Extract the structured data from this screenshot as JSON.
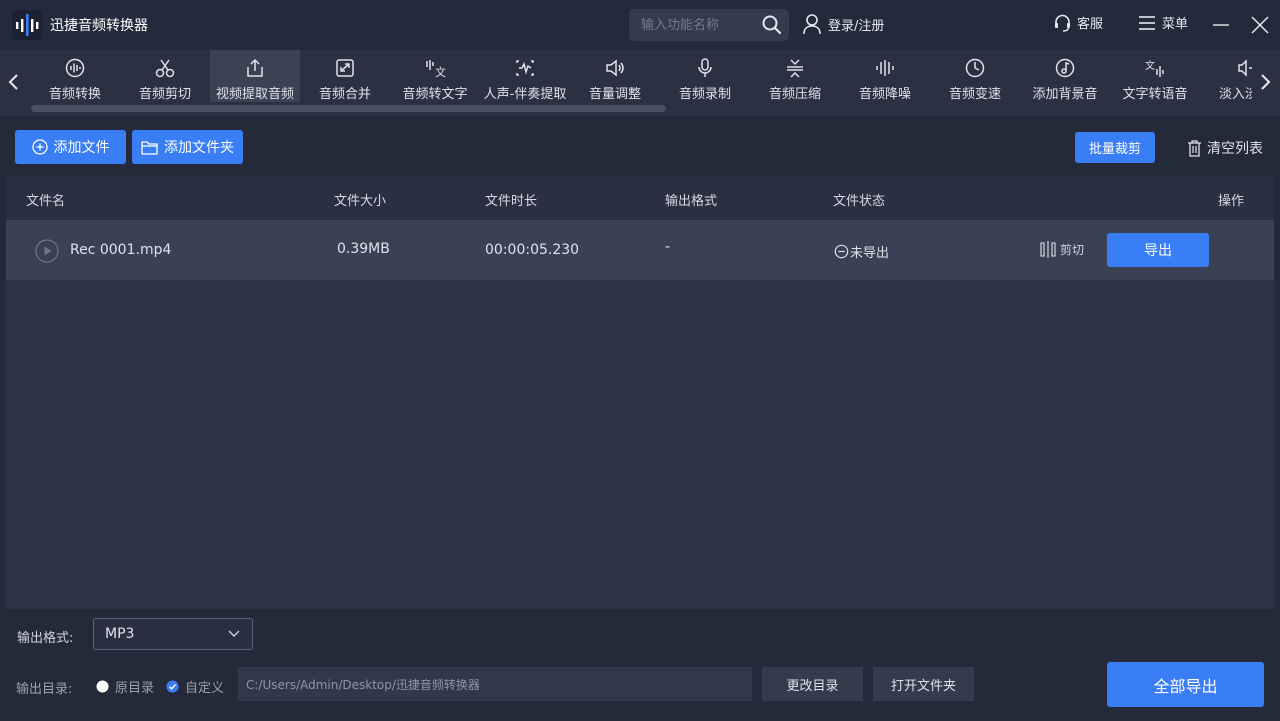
{
  "app": {
    "title": "迅捷音频转换器"
  },
  "header": {
    "search_placeholder": "输入功能名称",
    "login_label": "登录/注册",
    "service_label": "客服",
    "menu_label": "菜单"
  },
  "tools": [
    {
      "label": "音频转换",
      "icon": "waveform-circle-icon"
    },
    {
      "label": "音频剪切",
      "icon": "scissors-icon"
    },
    {
      "label": "视频提取音频",
      "icon": "upload-box-icon",
      "active": true
    },
    {
      "label": "音频合并",
      "icon": "merge-icon"
    },
    {
      "label": "音频转文字",
      "icon": "audio-to-text-icon"
    },
    {
      "label": "人声-伴奏提取",
      "icon": "vocal-extract-icon"
    },
    {
      "label": "音量调整",
      "icon": "volume-icon"
    },
    {
      "label": "音频录制",
      "icon": "microphone-icon"
    },
    {
      "label": "音频压缩",
      "icon": "compress-icon"
    },
    {
      "label": "音频降噪",
      "icon": "denoise-icon"
    },
    {
      "label": "音频变速",
      "icon": "speed-gauge-icon"
    },
    {
      "label": "添加背景音",
      "icon": "music-note-icon"
    },
    {
      "label": "文字转语音",
      "icon": "text-to-speech-icon"
    },
    {
      "label": "淡入淡出",
      "icon": "fade-icon"
    }
  ],
  "actions": {
    "add_file": "添加文件",
    "add_folder": "添加文件夹",
    "batch_cut": "批量裁剪",
    "clear_list": "清空列表"
  },
  "table": {
    "headers": {
      "name": "文件名",
      "size": "文件大小",
      "duration": "文件时长",
      "format": "输出格式",
      "status": "文件状态",
      "ops": "操作"
    },
    "rows": [
      {
        "name": "Rec 0001.mp4",
        "size": "0.39MB",
        "duration": "00:00:05.230",
        "format": "-",
        "status": "未导出",
        "cut_label": "剪切",
        "export_label": "导出"
      }
    ]
  },
  "bottom": {
    "format_label": "输出格式:",
    "format_value": "MP3",
    "dir_label": "输出目录:",
    "radio_original": "原目录",
    "radio_custom": "自定义",
    "radio_selected": "custom",
    "path": "C:/Users/Admin/Desktop/迅捷音频转换器",
    "change_dir": "更改目录",
    "open_folder": "打开文件夹",
    "export_all": "全部导出"
  },
  "colors": {
    "accent": "#3a7ef6",
    "background": "#242a3a",
    "row_highlight": "#3a4154"
  }
}
